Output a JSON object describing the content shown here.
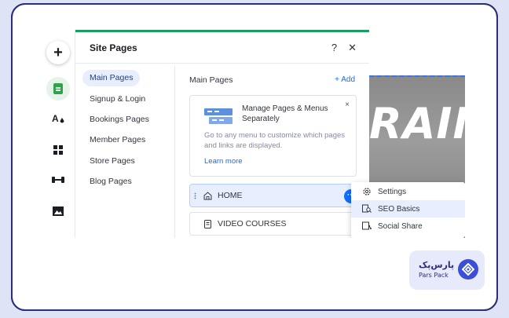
{
  "panel": {
    "title": "Site Pages",
    "help_label": "?",
    "close_label": "✕"
  },
  "categories": [
    {
      "label": "Main Pages",
      "active": true
    },
    {
      "label": "Signup & Login"
    },
    {
      "label": "Bookings Pages"
    },
    {
      "label": "Member Pages"
    },
    {
      "label": "Store Pages"
    },
    {
      "label": "Blog Pages"
    }
  ],
  "pages_section": {
    "heading": "Main Pages",
    "add_label": "+ Add"
  },
  "info_box": {
    "title": "Manage Pages & Menus Separately",
    "text": "Go to any menu to customize which pages and links are displayed.",
    "link": "Learn more",
    "close": "×"
  },
  "pages": [
    {
      "label": "HOME",
      "icon": "home-icon",
      "selected": true
    },
    {
      "label": "VIDEO COURSES",
      "icon": "page-icon"
    }
  ],
  "context_menu": [
    {
      "label": "Settings",
      "icon": "gear-icon"
    },
    {
      "label": "SEO Basics",
      "icon": "seo-icon",
      "highlighted": true
    },
    {
      "label": "Social Share",
      "icon": "share-icon"
    }
  ],
  "rail": [
    "add-icon",
    "pages-icon",
    "design-icon",
    "apps-icon",
    "business-icon",
    "media-icon"
  ],
  "preview": {
    "word": "RAIN"
  },
  "logo": {
    "fa": "پارس‌پک",
    "en": "Pars Pack"
  },
  "colors": {
    "accent": "#116dff",
    "green": "#1aa05c",
    "frame": "#2c2f7a"
  }
}
